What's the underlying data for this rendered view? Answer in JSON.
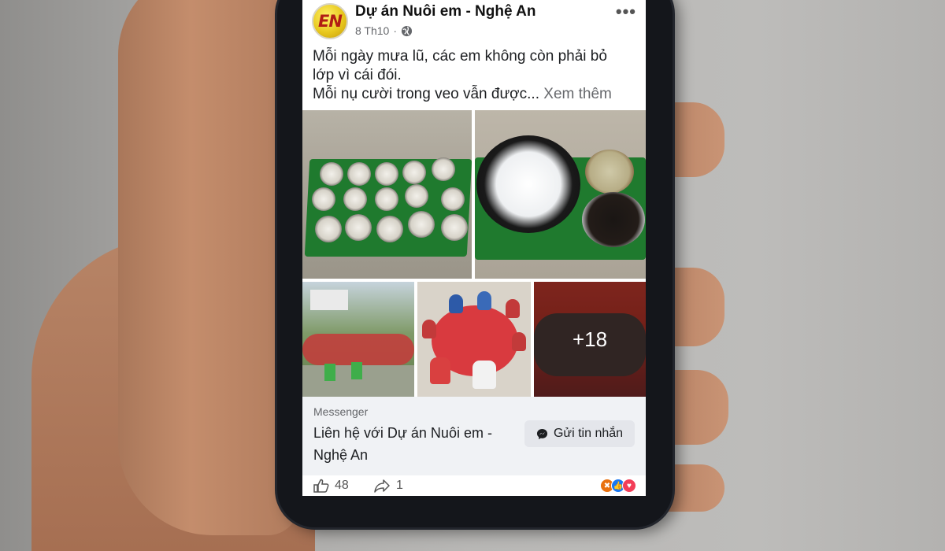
{
  "post": {
    "page_name": "Dự án Nuôi em - Nghệ An",
    "avatar_text": "EN",
    "date": "8 Th10",
    "separator": "·",
    "more_icon": "more-dots-icon",
    "text_lines": [
      "Mỗi ngày mưa lũ, các em không còn phải bỏ",
      "lớp vì cái đói.",
      "Mỗi nụ cười trong veo vẫn được..."
    ],
    "see_more": "Xem thêm"
  },
  "photos": {
    "more_count": "+18"
  },
  "cta": {
    "source": "Messenger",
    "title": "Liên hệ với Dự án Nuôi em - Nghệ An",
    "button_label": "Gửi tin nhắn"
  },
  "footer": {
    "likes": "48",
    "shares": "1"
  },
  "colors": {
    "accent": "#1877f2",
    "text_secondary": "#65676b",
    "cta_background": "#f0f2f5"
  }
}
